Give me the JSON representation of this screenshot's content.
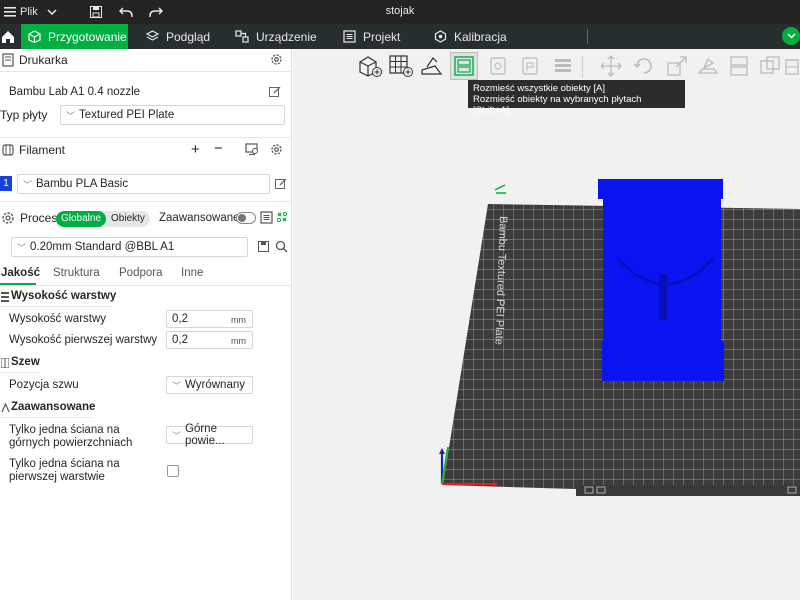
{
  "titlebar": {
    "menu_label": "Plik",
    "window_title": "stojak"
  },
  "tabs": [
    {
      "label": "Przygotowanie",
      "active": true
    },
    {
      "label": "Podgląd"
    },
    {
      "label": "Urządzenie"
    },
    {
      "label": "Projekt"
    },
    {
      "label": "Kalibracja"
    }
  ],
  "printer": {
    "header": "Drukarka",
    "preset": "Bambu Lab A1 0.4 nozzle",
    "plate_label": "Typ płyty",
    "plate_value": "Textured PEI Plate"
  },
  "filament": {
    "header": "Filament",
    "add_symbol": "+",
    "remove_symbol": "−",
    "items": [
      {
        "index": "1",
        "name": "Bambu PLA Basic",
        "color": "#1a3fd6"
      }
    ]
  },
  "process": {
    "header": "Proces",
    "mode_global": "Globalne",
    "mode_objects": "Obiekty",
    "advanced_label": "Zaawansowane",
    "preset": "0.20mm Standard @BBL A1",
    "tabs": [
      "Jakość",
      "Strukturа",
      "Podpora",
      "Inne"
    ]
  },
  "settings": {
    "layer_group": "Wysokość warstwy",
    "layer_height_label": "Wysokość warstwy",
    "layer_height_value": "0,2",
    "layer_height_unit": "mm",
    "first_layer_label": "Wysokość pierwszej warstwy",
    "first_layer_value": "0,2",
    "first_layer_unit": "mm",
    "seam_group": "Szew",
    "seam_position_label": "Pozycja szwu",
    "seam_position_value": "Wyrównany",
    "advanced_group": "Zaawansowane",
    "single_wall_top_label_1": "Tylko jedna ściana na",
    "single_wall_top_label_2": "górnych powierzchniach",
    "single_wall_top_value": "Górne powie...",
    "single_wall_first_label_1": "Tylko jedna ściana na",
    "single_wall_first_label_2": "pierwszej warstwie",
    "single_wall_first_checked": false
  },
  "viewport": {
    "plate_text": "Bambu Textured PEI Plate",
    "object_color": "#0a14f0"
  },
  "tooltip": {
    "line1": "Rozmieść wszystkie obiekty [A]",
    "line2": "Rozmieść obiekty na wybranych płytach [Shift+A]"
  },
  "colors": {
    "accent": "#00ae42",
    "titlebar": "#232323",
    "tabbar": "#262e30"
  }
}
